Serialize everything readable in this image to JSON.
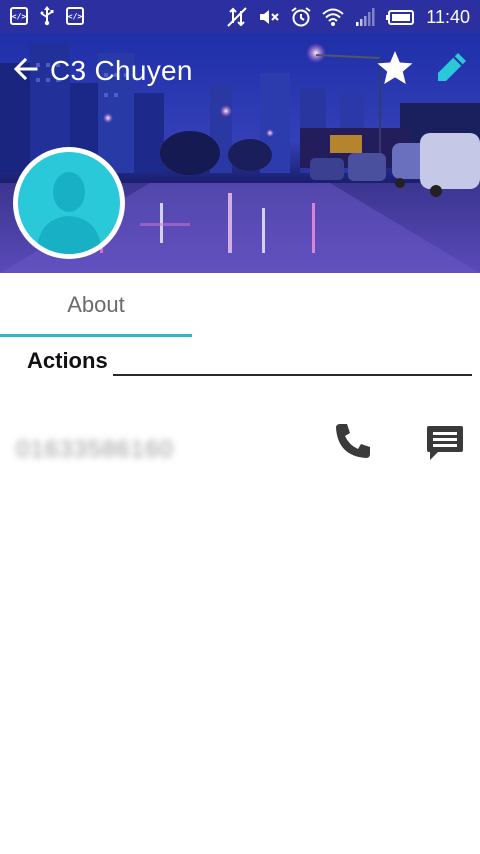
{
  "status_bar": {
    "time": "11:40",
    "left_icons": [
      "code-icon",
      "usb-icon",
      "code-icon"
    ],
    "right_icons": [
      "data-off-icon",
      "mute-icon",
      "alarm-icon",
      "wifi-icon",
      "signal-icon",
      "battery-icon"
    ],
    "left_badge_text": "</>"
  },
  "header": {
    "contact_name": "C3 Chuyen",
    "icons": {
      "back": "arrow-left-icon",
      "favorite": "star-icon",
      "edit": "pencil-icon"
    },
    "colors": {
      "accent": "#2bb8cc",
      "avatar_bg": "#29c9d9",
      "status_bar": "#2b2fa0"
    }
  },
  "tabs": [
    {
      "label": "About",
      "selected": true
    }
  ],
  "actions": {
    "title": "Actions",
    "phone_number": "01633586160",
    "icons": {
      "call": "phone-icon",
      "message": "message-icon"
    }
  }
}
